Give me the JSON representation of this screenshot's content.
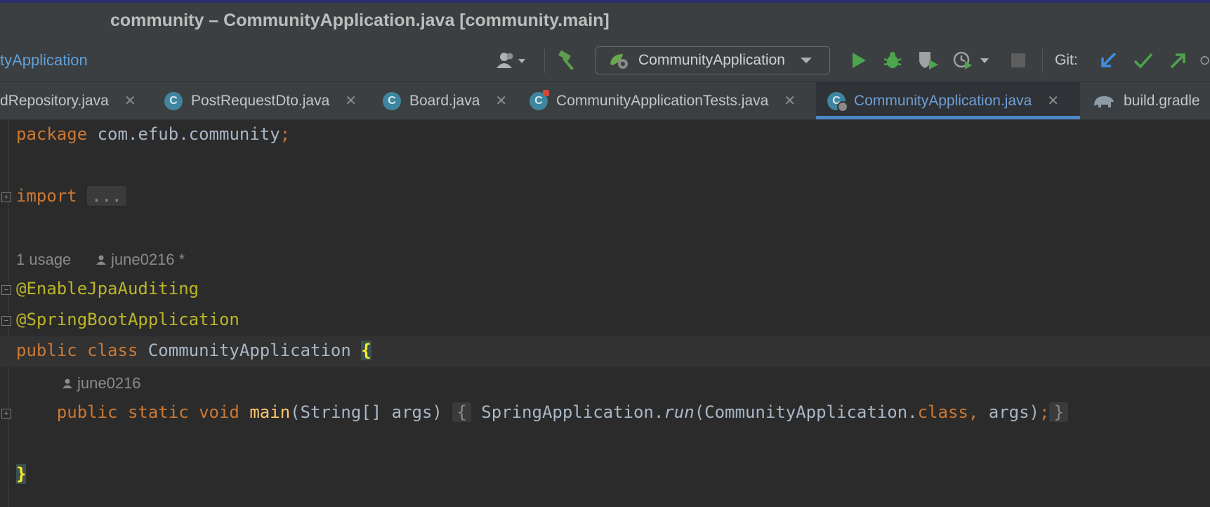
{
  "window": {
    "title": "community – CommunityApplication.java [community.main]"
  },
  "toolbar": {
    "breadcrumb": "tyApplication",
    "run_config": "CommunityApplication",
    "git_label": "Git:"
  },
  "tabs": [
    {
      "label": "dRepository.java",
      "icon": ""
    },
    {
      "label": "PostRequestDto.java",
      "icon": "class-icon"
    },
    {
      "label": "Board.java",
      "icon": "class-icon"
    },
    {
      "label": "CommunityApplicationTests.java",
      "icon": "test-class-icon"
    },
    {
      "label": "CommunityApplication.java",
      "icon": "spring-class-icon",
      "active": true
    },
    {
      "label": "build.gradle",
      "icon": "gradle-elephant-icon"
    }
  ],
  "editor": {
    "line1": {
      "kw": "package",
      "pkg": " com.efub.community",
      "semi": ";"
    },
    "line2": {
      "kw": "import",
      "fold": "..."
    },
    "hint1": {
      "usage": "1 usage",
      "author": "june0216 *"
    },
    "line3": "@EnableJpaAuditing",
    "line4": "@SpringBootApplication",
    "line5": {
      "kw": "public class",
      "name": " CommunityApplication ",
      "brace": "{"
    },
    "hint2": {
      "author": "june0216"
    },
    "line6": {
      "indent": "    ",
      "kw": "public static void",
      "fn": "main",
      "params": "(String[] args)",
      "fold_open": "{",
      "body1": " SpringApplication.",
      "run": "run",
      "body2": "(CommunityApplication.",
      "kw_class": "class",
      "comma": ",",
      "body3": " args)",
      "semi": ";",
      "fold_close": "}"
    },
    "line7": {
      "brace": "}"
    }
  },
  "colors": {
    "keyword": "#cc7832",
    "annotation": "#bbb529",
    "function": "#ffc66d",
    "text": "#a9b7c6",
    "accent": "#4a88c7"
  }
}
